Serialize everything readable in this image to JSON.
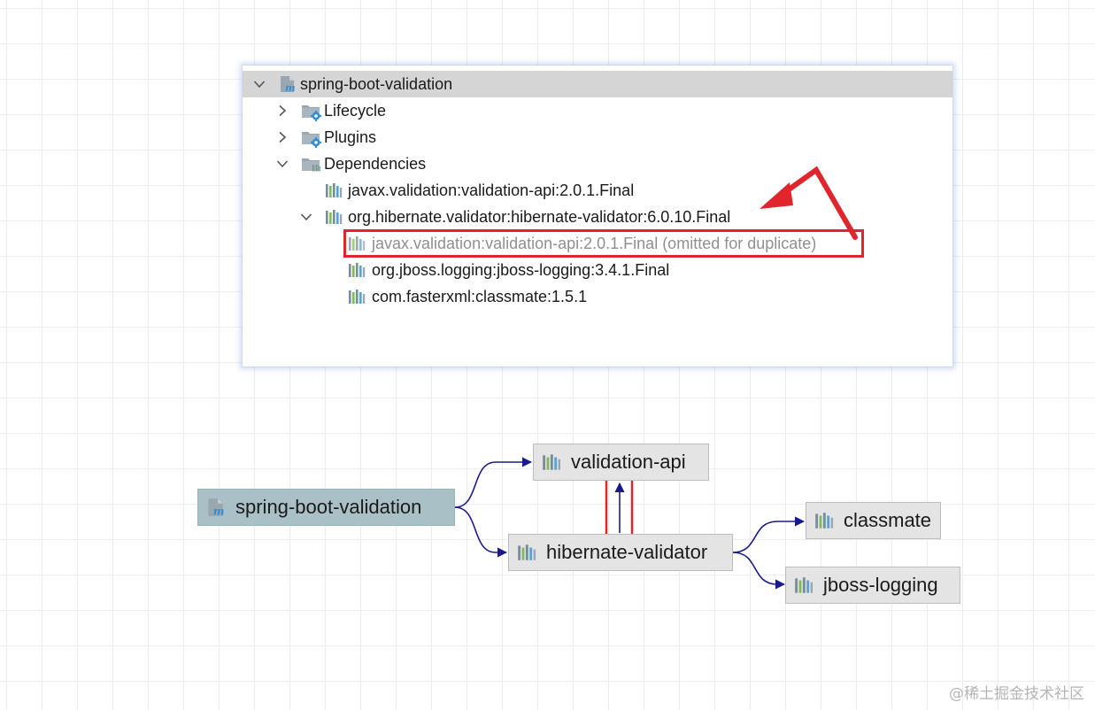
{
  "tree": {
    "root": {
      "label": "spring-boot-validation",
      "icon": "maven-module-icon",
      "expanded": true
    },
    "lifecycle": {
      "label": "Lifecycle",
      "icon": "folder-gear-icon",
      "expanded": false
    },
    "plugins": {
      "label": "Plugins",
      "icon": "folder-gear-icon",
      "expanded": false
    },
    "dependencies": {
      "label": "Dependencies",
      "icon": "folder-library-icon",
      "expanded": true,
      "items": [
        {
          "label": "javax.validation:validation-api:2.0.1.Final",
          "icon": "library-icon"
        },
        {
          "label": "org.hibernate.validator:hibernate-validator:6.0.10.Final",
          "icon": "library-icon",
          "expanded": true,
          "children": [
            {
              "label": "javax.validation:validation-api:2.0.1.Final (omitted for duplicate)",
              "icon": "library-icon",
              "omitted": true
            },
            {
              "label": "org.jboss.logging:jboss-logging:3.4.1.Final",
              "icon": "library-icon"
            },
            {
              "label": "com.fasterxml:classmate:1.5.1",
              "icon": "library-icon"
            }
          ]
        }
      ]
    }
  },
  "graph": {
    "nodes": {
      "root": {
        "label": "spring-boot-validation",
        "icon": "maven-module-icon"
      },
      "validation_api": {
        "label": "validation-api",
        "icon": "library-icon"
      },
      "hibernate_validator": {
        "label": "hibernate-validator",
        "icon": "library-icon"
      },
      "classmate": {
        "label": "classmate",
        "icon": "library-icon"
      },
      "jboss_logging": {
        "label": "jboss-logging",
        "icon": "library-icon"
      }
    },
    "edges": [
      {
        "from": "spring-boot-validation",
        "to": "validation-api"
      },
      {
        "from": "spring-boot-validation",
        "to": "hibernate-validator"
      },
      {
        "from": "hibernate-validator",
        "to": "validation-api"
      },
      {
        "from": "hibernate-validator",
        "to": "classmate"
      },
      {
        "from": "hibernate-validator",
        "to": "jboss-logging"
      }
    ]
  },
  "watermark": "@稀土掘金技术社区",
  "colors": {
    "selection": "#d5d5d5",
    "annotation_red": "#e0252c",
    "edge_navy": "#1a1a8c",
    "root_node": "#a9c0c7",
    "node": "#e4e4e4",
    "muted_text": "#8f8f8f"
  }
}
